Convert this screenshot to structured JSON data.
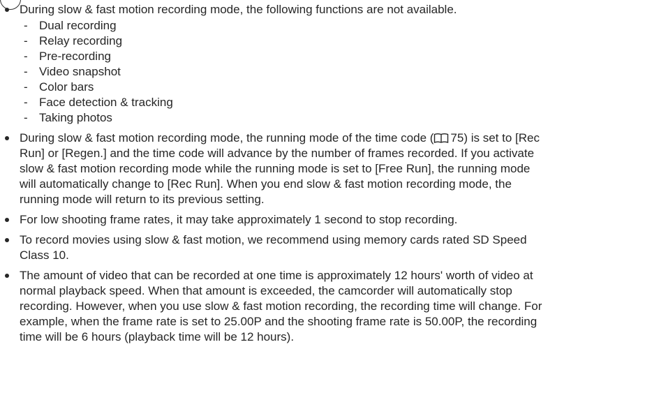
{
  "notes": {
    "intro": "During slow & fast motion recording mode, the following functions are not available.",
    "unavailable_functions": [
      "Dual recording",
      "Relay recording",
      "Pre-recording",
      "Video snapshot",
      "Color bars",
      "Face detection & tracking",
      "Taking photos"
    ],
    "timecode_before": "During slow & fast motion recording mode, the running mode of the time code (",
    "timecode_page": "75",
    "timecode_line1_end": ") is set to [Rec",
    "timecode_lines": [
      "Run] or [Regen.] and the time code will advance by the number of frames recorded. If you activate",
      "slow & fast motion recording mode while the running mode is set to [Free Run], the running mode",
      "will automatically change to [Rec Run]. When you end slow & fast motion recording mode, the",
      "running mode will return to its previous setting."
    ],
    "low_frame_rates": "For low shooting frame rates, it may take approximately 1 second to stop recording.",
    "memory_cards_lines": [
      "To record movies using slow & fast motion, we recommend using memory cards rated SD Speed",
      "Class 10."
    ],
    "recording_time_lines": [
      "The amount of video that can be recorded at one time is approximately 12 hours' worth of video at",
      "normal playback speed. When that amount is exceeded, the camcorder will automatically stop",
      "recording. However, when you use slow & fast motion recording, the recording time will change. For",
      "example, when the frame rate is set to 25.00P and the shooting frame rate is 50.00P, the recording",
      "time will be 6 hours (playback time will be 12 hours)."
    ]
  }
}
